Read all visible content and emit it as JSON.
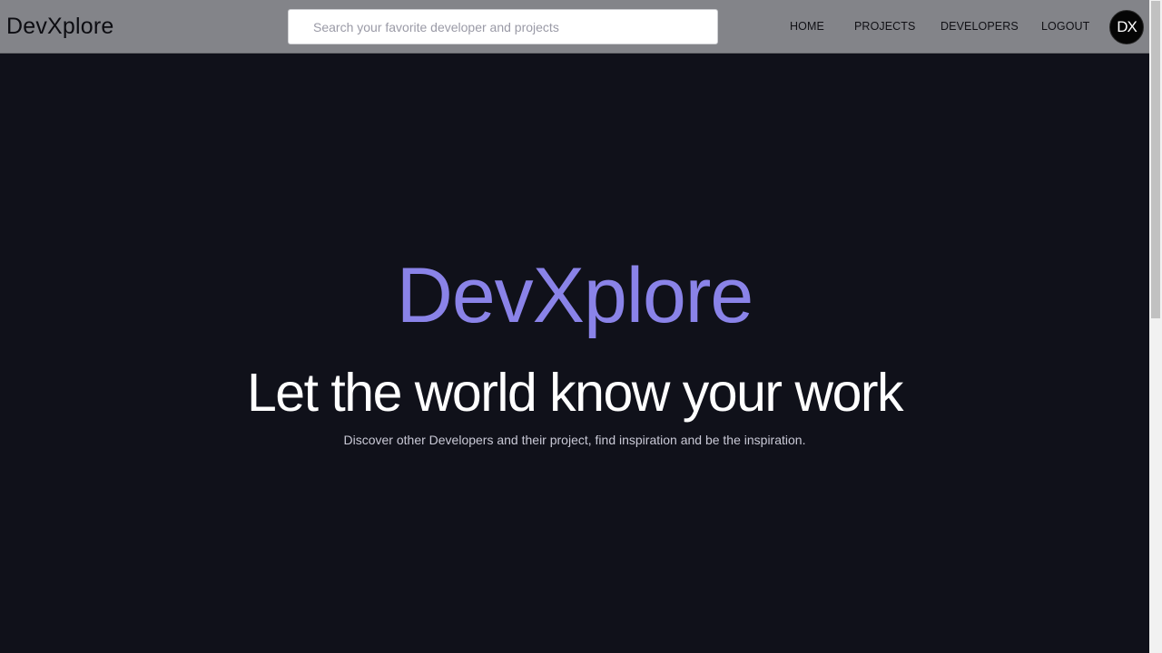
{
  "header": {
    "brand": "DevXplore",
    "search": {
      "placeholder": "Search your favorite developer and projects",
      "value": ""
    },
    "nav": [
      {
        "label": "HOME"
      },
      {
        "label": "PROJECTS"
      },
      {
        "label": "DEVELOPERS"
      },
      {
        "label": "LOGOUT"
      }
    ],
    "avatar": {
      "text": "DX"
    }
  },
  "hero": {
    "brand": "DevXplore",
    "title": "Let the world know your work",
    "subtitle": "Discover other Developers and their project, find inspiration and be the inspiration."
  },
  "colors": {
    "header_background": "#838489",
    "page_background": "#10111a",
    "accent": "#8a83e8",
    "title_text": "#ffffff",
    "subtitle_text": "#c9c9d6"
  }
}
